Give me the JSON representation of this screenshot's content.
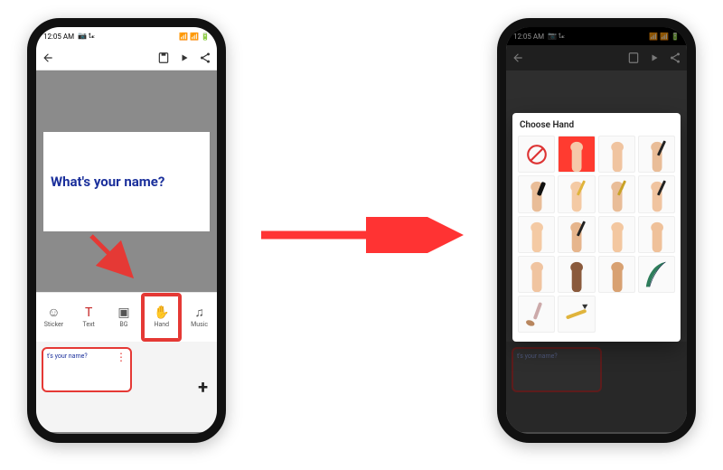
{
  "left_phone": {
    "status": {
      "time": "12:05 AM",
      "indicators": "📷 t𝔁",
      "right": "📶 📶 🔋"
    },
    "canvas_text": "What's your name?",
    "toolbar": {
      "items": [
        {
          "label": "Sticker",
          "icon": "☺"
        },
        {
          "label": "Text",
          "icon": "T"
        },
        {
          "label": "BG",
          "icon": "▣"
        },
        {
          "label": "Hand",
          "icon": "✋"
        },
        {
          "label": "Music",
          "icon": "♫"
        }
      ],
      "highlighted_index": 3
    },
    "timeline": {
      "clip_text": "t's your name?",
      "add_label": "+"
    }
  },
  "right_phone": {
    "status": {
      "time": "12:05 AM",
      "indicators": "📷 t𝔁",
      "right": "📶 📶 🔋"
    },
    "dialog": {
      "title": "Choose Hand",
      "rows": 5,
      "cols": 4,
      "items": [
        {
          "name": "none",
          "kind": "none"
        },
        {
          "name": "hand-red-bg",
          "kind": "arm",
          "skin": "#f6c9a9",
          "bg": "red"
        },
        {
          "name": "hand-light-1",
          "kind": "arm",
          "skin": "#f0c4a0"
        },
        {
          "name": "hand-pen-dark",
          "kind": "arm",
          "skin": "#e9bd98",
          "tool": "pen-dark"
        },
        {
          "name": "hand-marker",
          "kind": "arm",
          "skin": "#e9bd98",
          "tool": "marker"
        },
        {
          "name": "hand-pencil-1",
          "kind": "arm",
          "skin": "#f4caa4",
          "tool": "pencil"
        },
        {
          "name": "hand-pen-gold",
          "kind": "arm",
          "skin": "#e9bd98",
          "tool": "pen-gold"
        },
        {
          "name": "hand-stylus",
          "kind": "arm",
          "skin": "#f0c4a0",
          "tool": "pen-dark"
        },
        {
          "name": "hand-light-2",
          "kind": "arm",
          "skin": "#f4caa4"
        },
        {
          "name": "hand-pen-2",
          "kind": "arm",
          "skin": "#e6b58c",
          "tool": "pen-dark"
        },
        {
          "name": "hand-light-3",
          "kind": "arm",
          "skin": "#f3c7a0"
        },
        {
          "name": "hand-light-4",
          "kind": "arm",
          "skin": "#efc19a"
        },
        {
          "name": "hand-fist-1",
          "kind": "arm",
          "skin": "#f0c4a0"
        },
        {
          "name": "hand-dark-1",
          "kind": "arm",
          "skin": "#8a5a3c"
        },
        {
          "name": "hand-tan-1",
          "kind": "arm",
          "skin": "#d8a172"
        },
        {
          "name": "feather",
          "kind": "feather"
        },
        {
          "name": "brush",
          "kind": "brush"
        },
        {
          "name": "pencil",
          "kind": "pencil"
        },
        {
          "name": "empty-1",
          "kind": "empty"
        },
        {
          "name": "empty-2",
          "kind": "empty"
        }
      ]
    },
    "timeline": {
      "clip_text": "t's your name?"
    }
  }
}
